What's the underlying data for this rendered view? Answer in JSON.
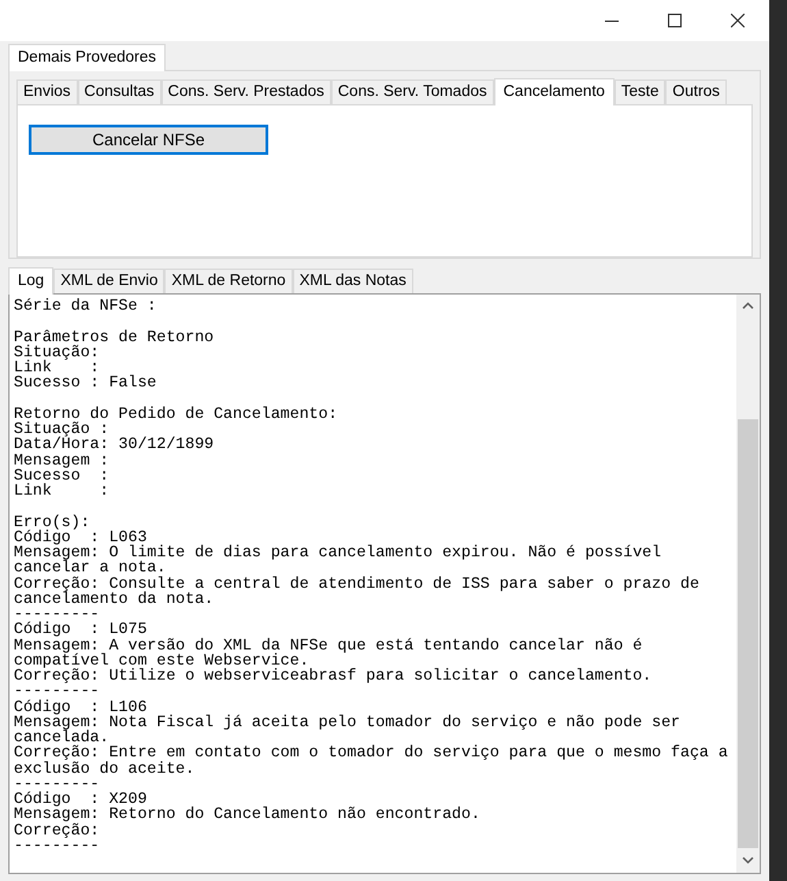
{
  "window_controls": [
    {
      "kind": "minimize"
    },
    {
      "kind": "maximize"
    },
    {
      "kind": "close"
    }
  ],
  "outer_tabs": [
    {
      "label": "Demais Provedores",
      "selected": true
    }
  ],
  "inner_tabs": [
    {
      "label": "Envios",
      "selected": false
    },
    {
      "label": "Consultas",
      "selected": false
    },
    {
      "label": "Cons. Serv. Prestados",
      "selected": false
    },
    {
      "label": "Cons. Serv. Tomados",
      "selected": false
    },
    {
      "label": "Cancelamento",
      "selected": true
    },
    {
      "label": "Teste",
      "selected": false
    },
    {
      "label": "Outros",
      "selected": false
    }
  ],
  "cancel_button": {
    "label": "Cancelar NFSe"
  },
  "log_tabs": [
    {
      "label": "Log",
      "selected": true
    },
    {
      "label": "XML de Envio",
      "selected": false
    },
    {
      "label": "XML de Retorno",
      "selected": false
    },
    {
      "label": "XML das Notas",
      "selected": false
    }
  ],
  "log_blocks": [
    [
      "Série da NFSe :"
    ],
    [
      "Parâmetros de Retorno",
      "Situação:",
      "Link    :",
      "Sucesso : False"
    ],
    [
      "Retorno do Pedido de Cancelamento:",
      "Situação :",
      "Data/Hora: 30/12/1899",
      "Mensagem :",
      "Sucesso  :",
      "Link     :"
    ],
    [
      "Erro(s):",
      "Código  : L063",
      "Mensagem: O limite de dias para cancelamento expirou. Não é possível",
      "cancelar a nota.",
      "Correção: Consulte a central de atendimento de ISS para saber o prazo de",
      "cancelamento da nota.",
      "---------",
      "Código  : L075",
      "Mensagem: A versão do XML da NFSe que está tentando cancelar não é",
      "compatível com este Webservice.",
      "Correção: Utilize o webserviceabrasf para solicitar o cancelamento.",
      "---------",
      "Código  : L106",
      "Mensagem: Nota Fiscal já aceita pelo tomador do serviço e não pode ser",
      "cancelada.",
      "Correção: Entre em contato com o tomador do serviço para que o mesmo faça a",
      "exclusão do aceite.",
      "---------",
      "Código  : X209",
      "Mensagem: Retorno do Cancelamento não encontrado.",
      "Correção:",
      "---------"
    ]
  ]
}
